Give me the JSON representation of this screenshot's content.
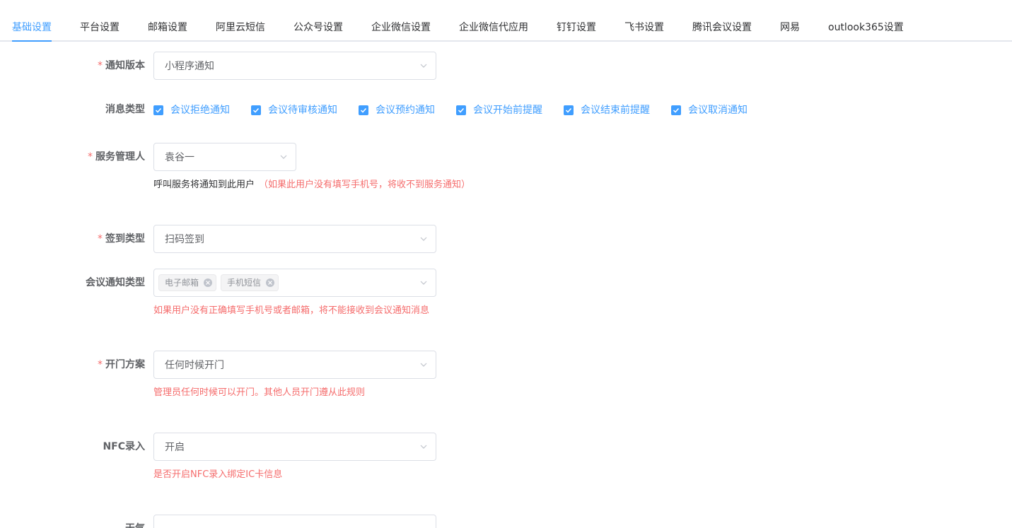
{
  "tabs": [
    {
      "label": "基础设置"
    },
    {
      "label": "平台设置"
    },
    {
      "label": "邮箱设置"
    },
    {
      "label": "阿里云短信"
    },
    {
      "label": "公众号设置"
    },
    {
      "label": "企业微信设置"
    },
    {
      "label": "企业微信代应用"
    },
    {
      "label": "钉钉设置"
    },
    {
      "label": "飞书设置"
    },
    {
      "label": "腾讯会议设置"
    },
    {
      "label": "网易"
    },
    {
      "label": "outlook365设置"
    }
  ],
  "active_tab": "基础设置",
  "accent_color": "#409eff",
  "error_color": "#f56c6c",
  "required_mark": "*",
  "form": {
    "notify_version": {
      "label": "通知版本",
      "value": "小程序通知"
    },
    "message_type": {
      "label": "消息类型",
      "options": [
        {
          "label": "会议拒绝通知",
          "checked": true
        },
        {
          "label": "会议待审核通知",
          "checked": true
        },
        {
          "label": "会议预约通知",
          "checked": true
        },
        {
          "label": "会议开始前提醒",
          "checked": true
        },
        {
          "label": "会议结束前提醒",
          "checked": true
        },
        {
          "label": "会议取消通知",
          "checked": true
        }
      ]
    },
    "service_manager": {
      "label": "服务管理人",
      "value": "袁谷一",
      "hint": "呼叫服务将通知到此用户",
      "warning": "（如果此用户没有填写手机号，将收不到服务通知）"
    },
    "checkin_type": {
      "label": "签到类型",
      "value": "扫码签到"
    },
    "meeting_notify_type": {
      "label": "会议通知类型",
      "tags": [
        "电子邮箱",
        "手机短信"
      ],
      "hint": "如果用户没有正确填写手机号或者邮箱，将不能接收到会议通知消息"
    },
    "door_plan": {
      "label": "开门方案",
      "value": "任何时候开门",
      "hint": "管理员任何时候可以开门。其他人员开门遵从此规则"
    },
    "nfc": {
      "label": "NFC录入",
      "value": "开启",
      "hint": "是否开启NFC录入绑定IC卡信息"
    },
    "weather": {
      "label": "天气"
    }
  }
}
